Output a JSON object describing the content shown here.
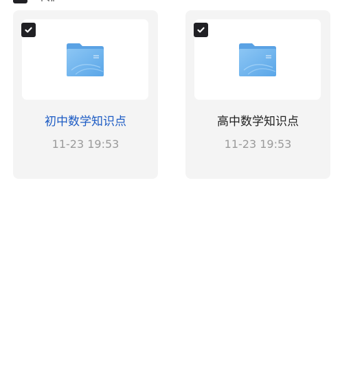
{
  "header": {
    "select_all_label": "全选"
  },
  "files": [
    {
      "name": "初中数学知识点",
      "modified": "11-23 19:53",
      "checked": true,
      "active": true,
      "icon": "folder-icon"
    },
    {
      "name": "高中数学知识点",
      "modified": "11-23 19:53",
      "checked": true,
      "active": false,
      "icon": "folder-icon"
    }
  ],
  "colors": {
    "card_bg": "#f4f4f4",
    "checkbox": "#202024",
    "active_name": "#1c5bc4",
    "time_text": "#9a9a9a",
    "folder_blue": "#6fb3ec"
  }
}
